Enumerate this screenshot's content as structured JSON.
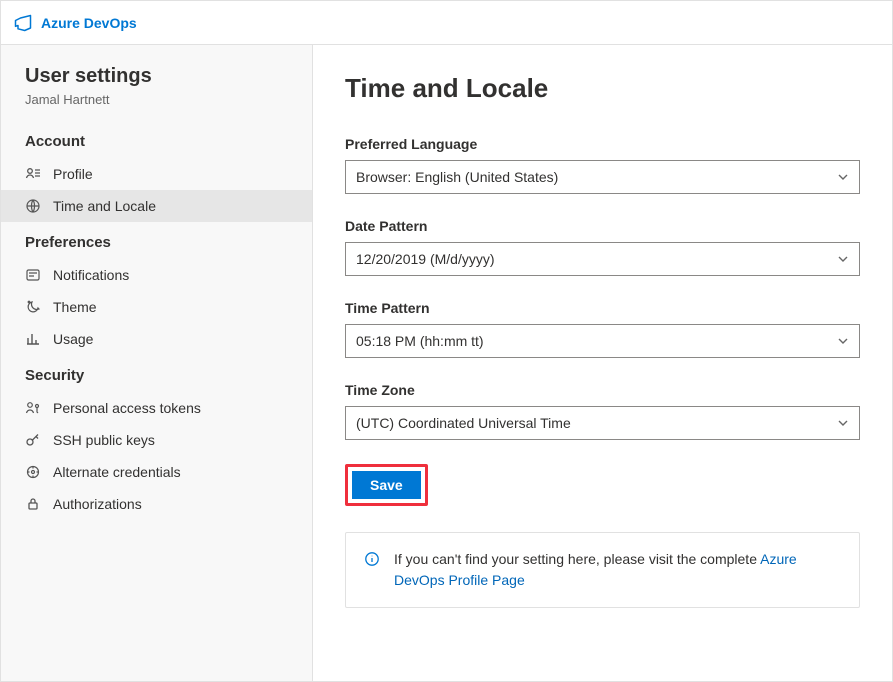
{
  "header": {
    "brand": "Azure DevOps"
  },
  "sidebar": {
    "title": "User settings",
    "user": "Jamal Hartnett",
    "sections": [
      {
        "label": "Account",
        "items": [
          {
            "id": "profile",
            "label": "Profile",
            "active": false
          },
          {
            "id": "time-locale",
            "label": "Time and Locale",
            "active": true
          }
        ]
      },
      {
        "label": "Preferences",
        "items": [
          {
            "id": "notifications",
            "label": "Notifications",
            "active": false
          },
          {
            "id": "theme",
            "label": "Theme",
            "active": false
          },
          {
            "id": "usage",
            "label": "Usage",
            "active": false
          }
        ]
      },
      {
        "label": "Security",
        "items": [
          {
            "id": "pat",
            "label": "Personal access tokens",
            "active": false
          },
          {
            "id": "ssh",
            "label": "SSH public keys",
            "active": false
          },
          {
            "id": "altcred",
            "label": "Alternate credentials",
            "active": false
          },
          {
            "id": "auth",
            "label": "Authorizations",
            "active": false
          }
        ]
      }
    ]
  },
  "main": {
    "title": "Time and Locale",
    "fields": {
      "language": {
        "label": "Preferred Language",
        "value": "Browser: English (United States)"
      },
      "date": {
        "label": "Date Pattern",
        "value": "12/20/2019 (M/d/yyyy)"
      },
      "time": {
        "label": "Time Pattern",
        "value": "05:18 PM (hh:mm tt)"
      },
      "tz": {
        "label": "Time Zone",
        "value": "(UTC) Coordinated Universal Time"
      }
    },
    "save": "Save",
    "info": {
      "text_pre": "If you can't find your setting here, please visit the complete ",
      "link": "Azure DevOps Profile Page"
    }
  }
}
